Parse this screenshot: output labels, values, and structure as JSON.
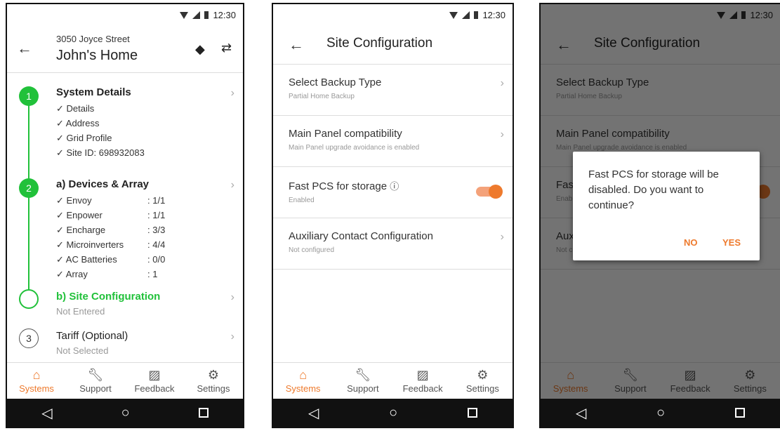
{
  "status": {
    "time": "12:30"
  },
  "screen1": {
    "address": "3050 Joyce Street",
    "title": "John's Home",
    "steps": [
      {
        "num": "1",
        "title": "System Details",
        "items": [
          "✓ Details",
          "✓ Address",
          "✓ Grid Profile",
          "✓ Site ID: 698932083"
        ]
      },
      {
        "num": "2",
        "title": "a) Devices & Array",
        "items": [
          {
            "label": "✓ Envoy",
            "value": ": 1/1"
          },
          {
            "label": "✓ Enpower",
            "value": ": 1/1"
          },
          {
            "label": "✓ Encharge",
            "value": ": 3/3"
          },
          {
            "label": "✓ Microinverters",
            "value": ": 4/4"
          },
          {
            "label": "✓ AC Batteries",
            "value": ": 0/0"
          },
          {
            "label": "✓ Array",
            "value": ": 1"
          }
        ]
      },
      {
        "title": "b) Site Configuration",
        "sub": "Not Entered"
      },
      {
        "num": "3",
        "title": "Tariff (Optional)",
        "sub": "Not Selected"
      }
    ]
  },
  "screen2": {
    "title": "Site Configuration",
    "rows": [
      {
        "title": "Select Backup Type",
        "sub": "Partial Home Backup"
      },
      {
        "title": "Main Panel compatibility",
        "sub": "Main Panel upgrade avoidance is enabled"
      },
      {
        "title": "Fast PCS for storage",
        "sub": "Enabled"
      },
      {
        "title": "Auxiliary Contact Configuration",
        "sub": "Not configured"
      }
    ]
  },
  "dialog": {
    "message": "Fast PCS for storage will be disabled. Do you want to continue?",
    "no": "NO",
    "yes": "YES"
  },
  "nav": [
    "Systems",
    "Support",
    "Feedback",
    "Settings"
  ],
  "colors": {
    "accent": "#ee7a2d",
    "green": "#21c13a"
  }
}
